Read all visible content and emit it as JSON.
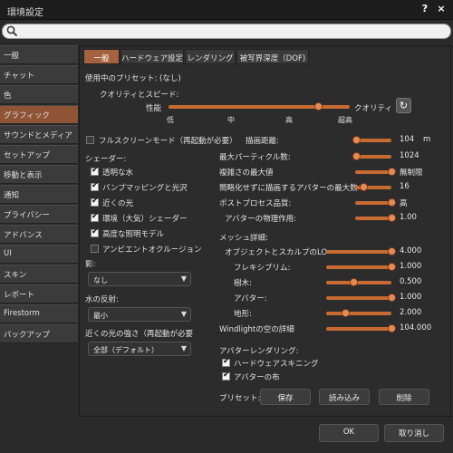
{
  "window": {
    "title": "環境設定",
    "help": "?",
    "close": "×"
  },
  "search": {
    "placeholder": "",
    "value": ""
  },
  "sidebar": {
    "items": [
      {
        "label": "一般"
      },
      {
        "label": "チャット"
      },
      {
        "label": "色"
      },
      {
        "label": "グラフィック",
        "active": true
      },
      {
        "label": "サウンドとメディア"
      },
      {
        "label": "セットアップ"
      },
      {
        "label": "移動と表示"
      },
      {
        "label": "通知"
      },
      {
        "label": "プライバシー"
      },
      {
        "label": "アドバンス"
      },
      {
        "label": "UI"
      },
      {
        "label": "スキン"
      },
      {
        "label": "レポート"
      },
      {
        "label": "Firestorm"
      },
      {
        "label": "バックアップ"
      }
    ]
  },
  "tabs": [
    {
      "label": "一般",
      "active": true
    },
    {
      "label": "ハードウェア設定"
    },
    {
      "label": "レンダリング"
    },
    {
      "label": "被写界深度（DOF)"
    }
  ],
  "preset_current": {
    "label": "使用中のプリセット:",
    "value": "(なし)"
  },
  "quality": {
    "label": "クオリティとスピード:",
    "left": "性能",
    "right": "クオリティ",
    "ticks": [
      "低",
      "中",
      "高",
      "超高"
    ],
    "level": 0.83
  },
  "fullscreen": {
    "label": "フルスクリーンモード（再起動が必要）",
    "checked": false
  },
  "shaders": {
    "label": "シェーダー:",
    "items": [
      {
        "label": "透明な水",
        "checked": true
      },
      {
        "label": "バンプマッピングと光沢",
        "checked": true
      },
      {
        "label": "近くの光",
        "checked": true
      },
      {
        "label": "環境（大気）シェーダー",
        "checked": true
      },
      {
        "label": "高度な照明モデル",
        "checked": true
      },
      {
        "label": "アンビエントオクルージョン",
        "checked": false
      }
    ]
  },
  "shadows": {
    "label": "影:",
    "value": "なし"
  },
  "water": {
    "label": "水の反射:",
    "value": "最小"
  },
  "nearby_light": {
    "label": "近くの光の強さ（再起動が必要",
    "value": "全部（デフォルト）"
  },
  "draw_distance": {
    "label": "描画距離:",
    "value": "104",
    "unit": "m",
    "level": 0.05
  },
  "right_settings": [
    {
      "label": "最大パーティクル数:",
      "value": "1024",
      "level": 0.05
    },
    {
      "label": "複雑さの最大値",
      "value": "無制限",
      "level": 0.97
    },
    {
      "label": "簡略化せずに描画するアバターの最大数",
      "value": "16",
      "level": 0.22
    },
    {
      "label": "ポストプロセス品質:",
      "value": "高",
      "level": 0.97
    },
    {
      "label": "アバターの物理作用:",
      "value": "1.00",
      "level": 0.97
    }
  ],
  "mesh": {
    "label": "メッシュ詳細:",
    "items": [
      {
        "label": "オブジェクトとスカルプのLO",
        "value": "4.000",
        "level": 0.97
      },
      {
        "label": "フレキシプリム:",
        "value": "1.000",
        "level": 0.97
      },
      {
        "label": "樹木:",
        "value": "0.500",
        "level": 0.5
      },
      {
        "label": "アバター:",
        "value": "1.000",
        "level": 0.97
      },
      {
        "label": "地形:",
        "value": "2.000",
        "level": 0.33
      }
    ],
    "windlight_label": "Windlightの空の詳細",
    "windlight_value": "104.000",
    "windlight_level": 0.97
  },
  "avatar_rendering": {
    "label": "アバターレンダリング:",
    "items": [
      {
        "label": "ハードウェアスキニング",
        "checked": true
      },
      {
        "label": "アバターの布",
        "checked": true
      }
    ]
  },
  "presets": {
    "label": "プリセット:",
    "save": "保存",
    "load": "読み込み",
    "delete": "削除"
  },
  "footer": {
    "ok": "OK",
    "cancel": "取り消し"
  },
  "colors": {
    "accent": "#a4623f",
    "slider": "#c76b32",
    "background": "#2c2c2c"
  }
}
